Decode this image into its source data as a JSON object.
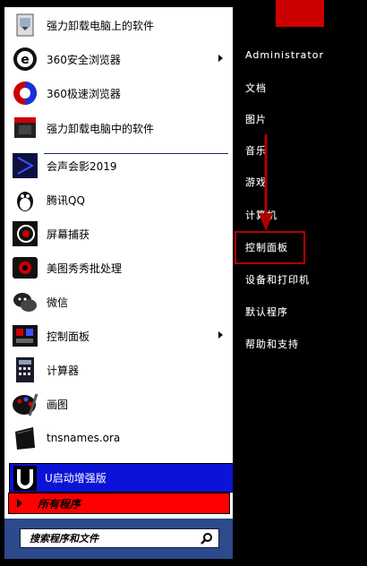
{
  "pinned_programs": [
    {
      "label": "强力卸载电脑上的软件",
      "icon": "uninstall-software-icon",
      "submenu": false
    },
    {
      "label": "360安全浏览器",
      "icon": "360-safe-browser-icon",
      "submenu": true
    },
    {
      "label": "360极速浏览器",
      "icon": "360-speed-browser-icon",
      "submenu": false
    },
    {
      "label": "强力卸载电脑中的软件",
      "icon": "uninstall-box-icon",
      "submenu": false
    }
  ],
  "recent_programs": [
    {
      "label": "会声会影2019",
      "icon": "video-editor-icon",
      "submenu": false
    },
    {
      "label": "腾讯QQ",
      "icon": "qq-penguin-icon",
      "submenu": false
    },
    {
      "label": "屏幕捕获",
      "icon": "screen-capture-icon",
      "submenu": false
    },
    {
      "label": "美图秀秀批处理",
      "icon": "meitu-batch-icon",
      "submenu": false
    },
    {
      "label": "微信",
      "icon": "wechat-icon",
      "submenu": false
    },
    {
      "label": "控制面板",
      "icon": "control-panel-icon",
      "submenu": true
    },
    {
      "label": "计算器",
      "icon": "calculator-icon",
      "submenu": false
    },
    {
      "label": "画图",
      "icon": "paint-icon",
      "submenu": false
    },
    {
      "label": "tnsnames.ora",
      "icon": "file-icon",
      "submenu": false
    }
  ],
  "u_boot": {
    "label": "U启动增强版",
    "icon": "u-boot-icon"
  },
  "all_programs": {
    "label": "所有程序"
  },
  "search": {
    "placeholder": "搜索程序和文件",
    "icon": "search-icon"
  },
  "right_pane": {
    "user_name": "Administrator",
    "items": [
      "文档",
      "图片",
      "音乐",
      "游戏",
      "计算机",
      "控制面板",
      "设备和打印机",
      "默认程序",
      "帮助和支持"
    ],
    "highlighted_item": "控制面板"
  },
  "colors": {
    "background": "#000000",
    "menu_background": "#ffffff",
    "u_boot_background": "#0b14d6",
    "all_programs_background": "#ff0000",
    "search_area": "#2c4a8c",
    "highlight_border": "#b00000",
    "arrow": "#b00000"
  }
}
